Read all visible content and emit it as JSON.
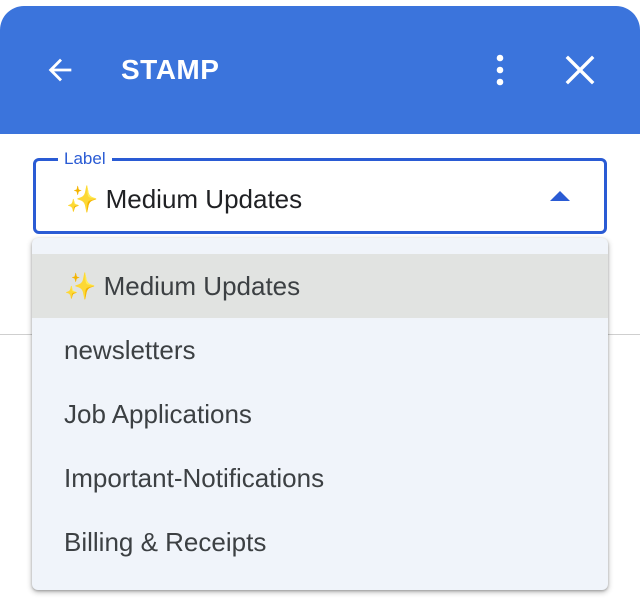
{
  "header": {
    "title": "STAMP",
    "back_icon": "arrow-left-icon",
    "more_icon": "more-vert-icon",
    "close_icon": "close-icon",
    "bg_color": "#3b74dc"
  },
  "label_field": {
    "label": "Label",
    "value": "✨ Medium Updates",
    "accent_color": "#2a5bd4",
    "caret_icon": "caret-up-icon"
  },
  "dropdown": {
    "selected_index": 0,
    "options": [
      "✨ Medium Updates",
      "newsletters",
      "Job Applications",
      "Important-Notifications",
      "Billing & Receipts"
    ]
  }
}
